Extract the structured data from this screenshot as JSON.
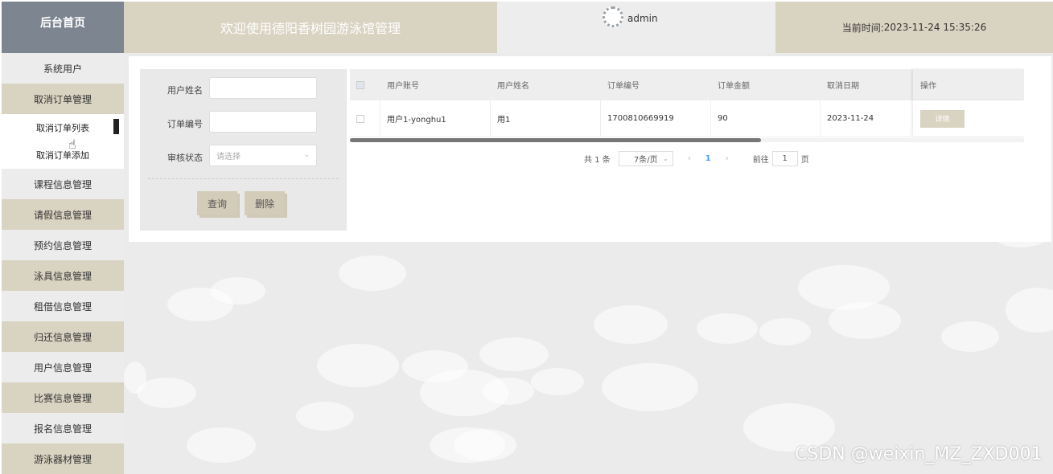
{
  "header": {
    "brand": "后台首页",
    "welcome": "欢迎使用德阳香树园游泳馆管理",
    "username": "admin",
    "time_label": "当前时间:",
    "time_value": "2023-11-24 15:35:26"
  },
  "sidebar": {
    "items": [
      {
        "label": "系统用户"
      },
      {
        "label": "取消订单管理"
      },
      {
        "label": "课程信息管理"
      },
      {
        "label": "请假信息管理"
      },
      {
        "label": "预约信息管理"
      },
      {
        "label": "泳具信息管理"
      },
      {
        "label": "租借信息管理"
      },
      {
        "label": "归还信息管理"
      },
      {
        "label": "用户信息管理"
      },
      {
        "label": "比赛信息管理"
      },
      {
        "label": "报名信息管理"
      },
      {
        "label": "游泳器材管理"
      }
    ],
    "sub_items": [
      {
        "label": "取消订单列表"
      },
      {
        "label": "取消订单添加"
      }
    ]
  },
  "search": {
    "fields": [
      {
        "label": "用户姓名",
        "value": ""
      },
      {
        "label": "订单编号",
        "value": ""
      },
      {
        "label": "审核状态",
        "placeholder": "请选择"
      }
    ],
    "query_button": "查询",
    "delete_button": "删除"
  },
  "table": {
    "columns": [
      "用户账号",
      "用户姓名",
      "订单编号",
      "订单金额",
      "取消日期",
      "操作"
    ],
    "rows": [
      {
        "account": "用户1-yonghu1",
        "name": "用1",
        "order_no": "1700810669919",
        "amount": "90",
        "date": "2023-11-24",
        "action": "详情"
      }
    ]
  },
  "pagination": {
    "total": "共 1 条",
    "page_size": "7条/页",
    "prev": "‹",
    "current": "1",
    "next": "›",
    "goto_label": "前往",
    "goto_value": "1",
    "goto_unit": "页"
  },
  "watermark": "CSDN @weixin_MZ_ZXD001",
  "colors": {
    "beige": "#d9d3c2",
    "slate": "#7d8591",
    "light": "#ececec"
  }
}
